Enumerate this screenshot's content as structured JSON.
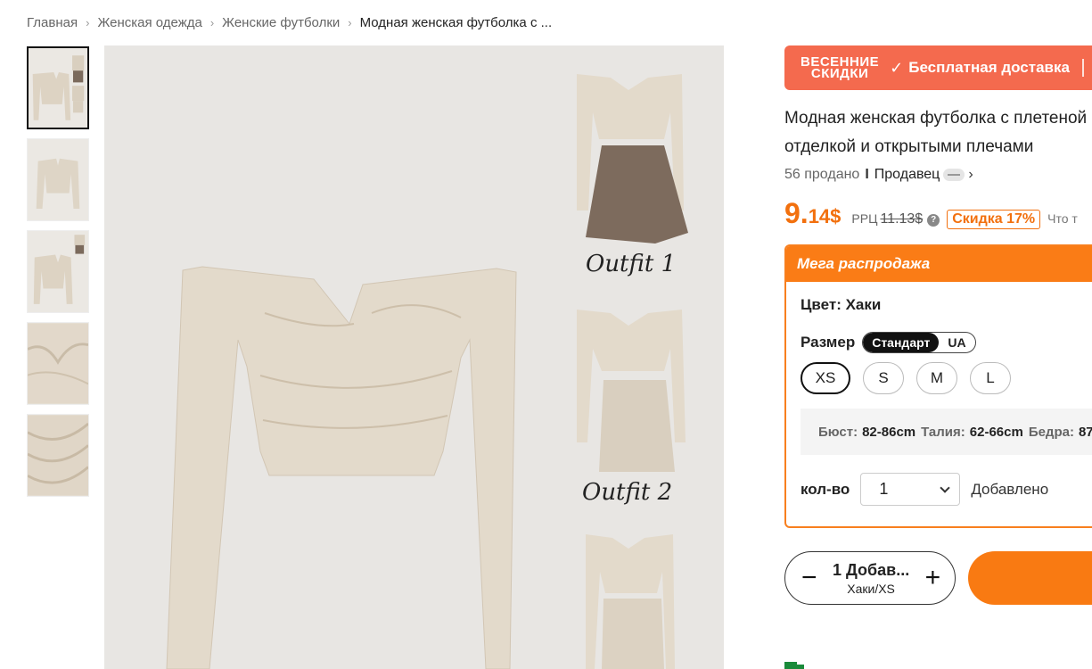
{
  "breadcrumb": {
    "items": [
      "Главная",
      "Женская одежда",
      "Женские футболки",
      "Модная женская футболка с ..."
    ]
  },
  "gallery": {
    "outfit_labels": [
      "Outfit 1",
      "Outfit 2"
    ]
  },
  "promo": {
    "badge_line1": "ВЕСЕННИЕ",
    "badge_line2": "СКИДКИ",
    "check": "✓",
    "text": "Бесплатная доставка"
  },
  "product": {
    "title": "Модная женская футболка с плетеной отделкой и открытыми плечами",
    "sold": "56 продано",
    "separator": "I",
    "seller": "Продавец",
    "chevron": "›"
  },
  "price": {
    "whole": "9.",
    "fraction": "14$",
    "rrp_label": "РРЦ",
    "rrp_old": "11.13$",
    "help": "?",
    "discount": "Скидка 17%",
    "what": "Что т"
  },
  "mega": {
    "header": "Мега распродажа",
    "color_label": "Цвет: Хаки",
    "size_label": "Размер",
    "size_standard_on": "Стандарт",
    "size_standard_off": "UA",
    "sizes": [
      "XS",
      "S",
      "M",
      "L"
    ],
    "selected_size": "XS",
    "measures": {
      "bust_label": "Бюст:",
      "bust_value": "82-86cm",
      "waist_label": "Талия:",
      "waist_value": "62-66cm",
      "hips_label": "Бедра:",
      "hips_value": "87"
    },
    "qty_label": "кол-во",
    "qty_value": "1",
    "qty_status": "Добавлено"
  },
  "cart": {
    "minus": "−",
    "plus": "+",
    "line1": "1 Добав...",
    "line2": "Хаки/XS"
  },
  "colors": {
    "accent": "#f2700e",
    "promo": "#f46a4e",
    "mega_header": "#fa7c16",
    "garment": "#e3dacb"
  },
  "icons": [
    "chevron-right-icon",
    "check-icon",
    "help-icon",
    "caret-down-icon",
    "minus-icon",
    "plus-icon",
    "delivery-truck-icon"
  ]
}
